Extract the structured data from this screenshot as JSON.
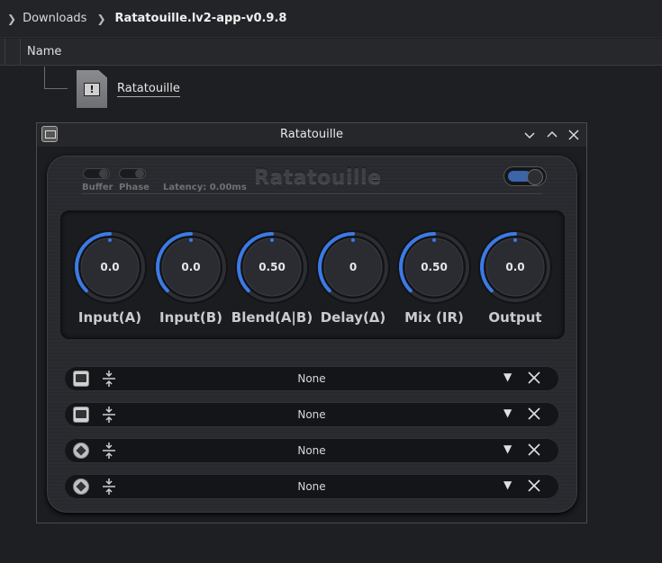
{
  "breadcrumb": {
    "parent": "Downloads",
    "current": "Ratatouille.lv2-app-v0.9.8"
  },
  "columns": {
    "name": "Name"
  },
  "file": {
    "label": "Ratatouille",
    "icon": "executable-file-icon"
  },
  "window": {
    "title": "Ratatouille",
    "minimize": "⌄",
    "maximize": "⌃",
    "close": "✕"
  },
  "plugin": {
    "name": "Ratatouille",
    "buffer_label": "Buffer",
    "phase_label": "Phase",
    "latency": "Latency: 0.00ms",
    "power": "on"
  },
  "knobs": [
    {
      "label": "Input(A)",
      "value": "0.0",
      "level": 0.5
    },
    {
      "label": "Input(B)",
      "value": "0.0",
      "level": 0.5
    },
    {
      "label": "Blend(A|B)",
      "value": "0.50",
      "level": 0.5
    },
    {
      "label": "Delay(Δ)",
      "value": "0",
      "level": 0.5
    },
    {
      "label": "Mix (IR)",
      "value": "0.50",
      "level": 0.5
    },
    {
      "label": "Output",
      "value": "0.0",
      "level": 0.5
    }
  ],
  "slots": [
    {
      "icon": "model-file-icon",
      "value": "None"
    },
    {
      "icon": "model-file-icon",
      "value": "None"
    },
    {
      "icon": "impulse-response-icon",
      "value": "None"
    },
    {
      "icon": "impulse-response-icon",
      "value": "None"
    }
  ],
  "colors": {
    "accent": "#3c7ae6",
    "background": "#1e1f22"
  }
}
